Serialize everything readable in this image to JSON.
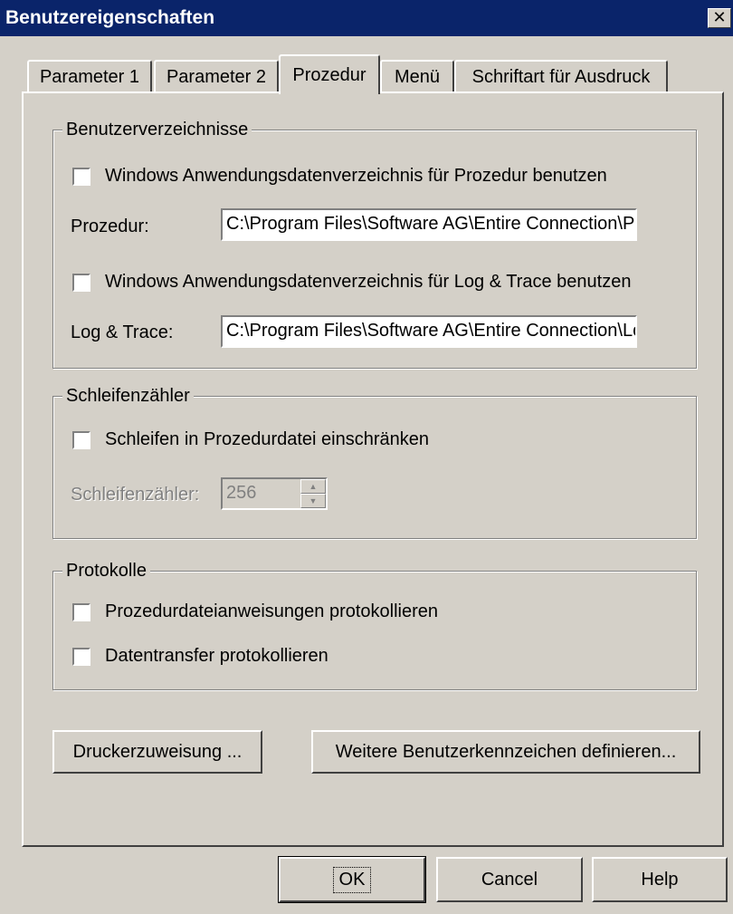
{
  "window": {
    "title": "Benutzereigenschaften",
    "close_glyph": "✕"
  },
  "tabs": [
    {
      "label": "Parameter 1"
    },
    {
      "label": "Parameter 2"
    },
    {
      "label": "Prozedur"
    },
    {
      "label": "Menü"
    },
    {
      "label": "Schriftart für Ausdruck"
    }
  ],
  "active_tab": "Prozedur",
  "user_dirs": {
    "title": "Benutzerverzeichnisse",
    "proc_checkbox_label": "Windows Anwendungsdatenverzeichnis für Prozedur benutzen",
    "proc_checked": false,
    "proc_label": "Prozedur:",
    "proc_value": "C:\\Program Files\\Software AG\\Entire Connection\\Proc",
    "log_checkbox_label": "Windows Anwendungsdatenverzeichnis für Log & Trace benutzen",
    "log_checked": false,
    "log_label": "Log & Trace:",
    "log_value": "C:\\Program Files\\Software AG\\Entire Connection\\Log"
  },
  "loop_counter": {
    "title": "Schleifenzähler",
    "checkbox_label": "Schleifen in Prozedurdatei einschränken",
    "checked": false,
    "counter_label": "Schleifenzähler:",
    "counter_value": "256"
  },
  "logs": {
    "title": "Protokolle",
    "proc_statements_label": "Prozedurdateianweisungen protokollieren",
    "data_transfer_label": "Datentransfer protokollieren"
  },
  "buttons": {
    "printer": "Druckerzuweisung ...",
    "more_flags": "Weitere Benutzerkennzeichen definieren...",
    "ok": "OK",
    "cancel": "Cancel",
    "help": "Help"
  },
  "colors": {
    "titlebar": "#0a246a",
    "face": "#d4d0c8"
  }
}
